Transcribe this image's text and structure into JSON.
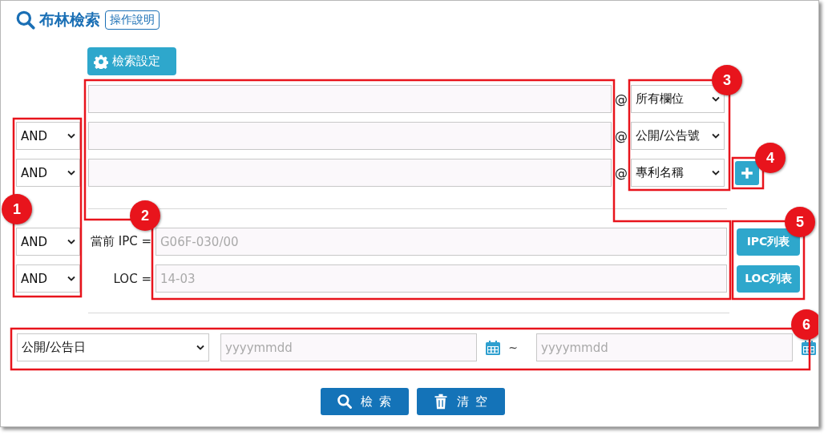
{
  "header": {
    "title": "布林檢索",
    "help_button": "操作說明"
  },
  "settings_button": "檢索設定",
  "keyword_rows": [
    {
      "at": "@",
      "field": "所有欄位"
    },
    {
      "operator": "AND",
      "at": "@",
      "field": "公開/公告號"
    },
    {
      "operator": "AND",
      "at": "@",
      "field": "專利名稱"
    }
  ],
  "classification_rows": [
    {
      "operator": "AND",
      "label": "當前 IPC =",
      "placeholder": "G06F-030/00",
      "button": "IPC列表"
    },
    {
      "operator": "AND",
      "label": "LOC =",
      "placeholder": "14-03",
      "button": "LOC列表"
    }
  ],
  "date_row": {
    "field": "公開/公告日",
    "from_placeholder": "yyyymmdd",
    "separator": "~",
    "to_placeholder": "yyyymmdd"
  },
  "actions": [
    {
      "kind": "search",
      "label": "檢 索"
    },
    {
      "kind": "clear",
      "label": "清 空"
    }
  ],
  "annotations": [
    "1",
    "2",
    "3",
    "4",
    "5",
    "6"
  ]
}
